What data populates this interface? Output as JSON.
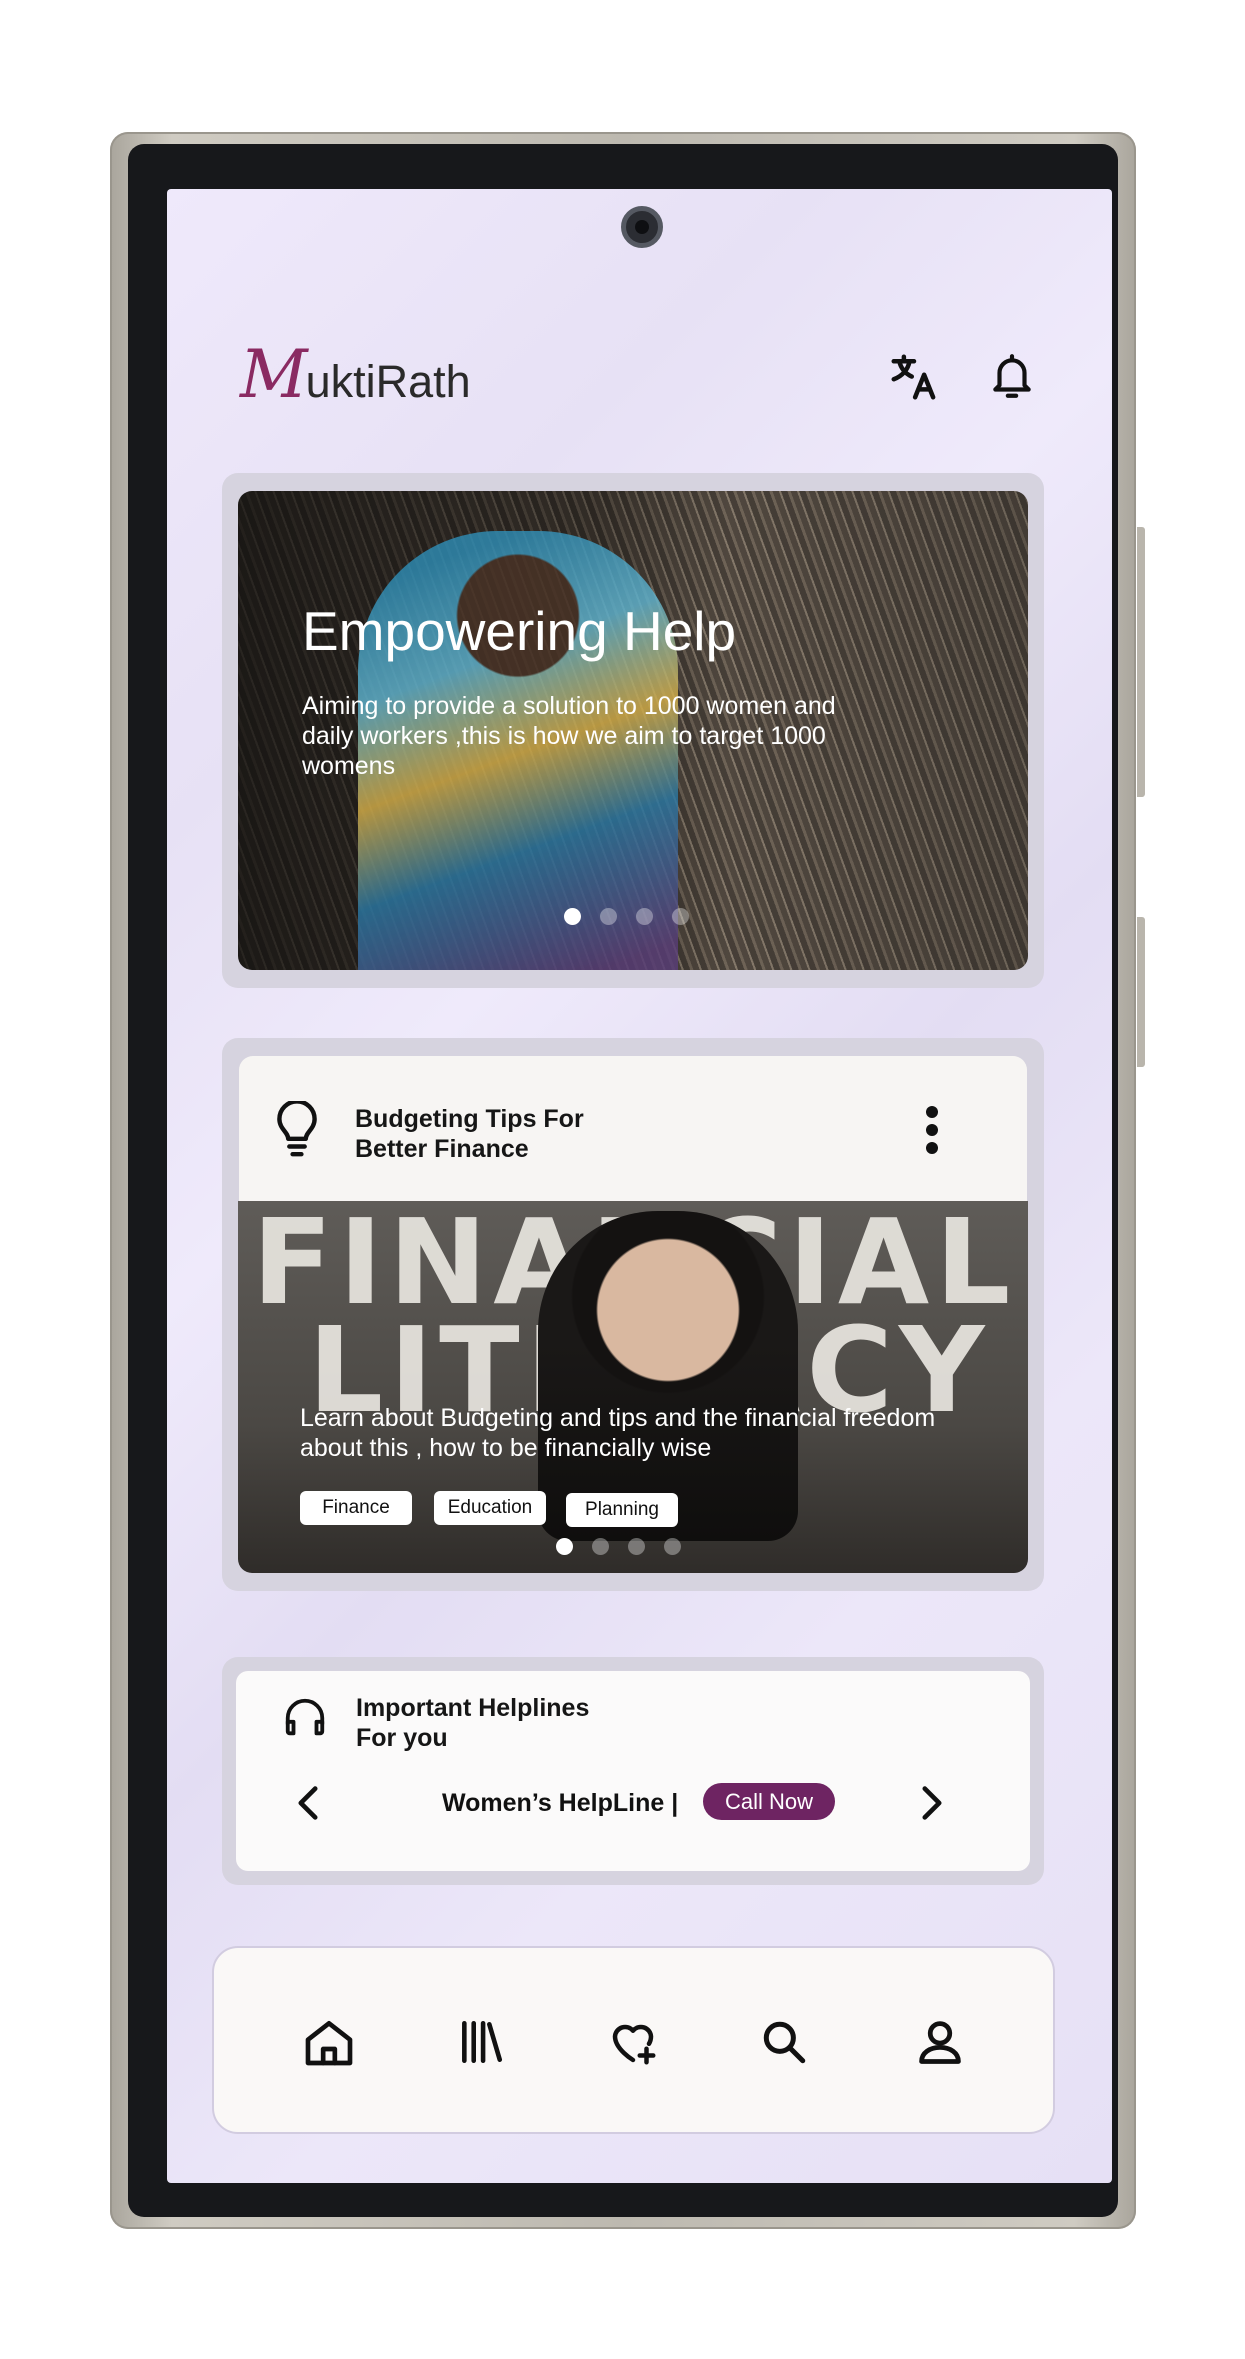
{
  "app": {
    "logo_initial": "M",
    "logo_rest": "uktiRath",
    "brand_color": "#8a2a62"
  },
  "header": {
    "icons": [
      "translate-icon",
      "bell-icon"
    ]
  },
  "hero": {
    "title": "Empowering Help",
    "description": "Aiming to provide a solution to 1000 women and daily workers ,this is how we aim to target 1000 womens",
    "carousel": {
      "slides": 4,
      "active": 1
    }
  },
  "tips": {
    "icon": "lightbulb-icon",
    "title_line1": "Budgeting Tips For",
    "title_line2": "Better Finance",
    "image_word1": "FINANCIAL",
    "image_word2": "LITERACY",
    "description": "Learn about Budgeting and tips and the financial freedom about this , how to be financially wise",
    "tags": [
      "Finance",
      "Education",
      "Planning"
    ],
    "carousel": {
      "slides": 4,
      "active": 1
    }
  },
  "helplines": {
    "icon": "headset-icon",
    "title_line1": "Important Helplines",
    "title_line2": "For you",
    "current_name": "Women’s HelpLine |",
    "call_label": "Call Now",
    "accent_color": "#6e2462"
  },
  "bottom_nav": {
    "items": [
      "home-icon",
      "library-icon",
      "heart-plus-icon",
      "search-icon",
      "profile-icon"
    ]
  }
}
